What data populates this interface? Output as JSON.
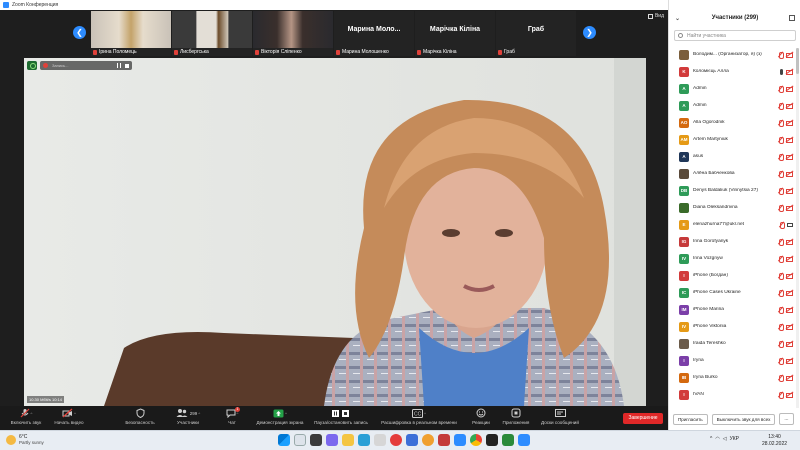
{
  "window": {
    "title": "Zoom Конференция"
  },
  "thumbnails": [
    {
      "name": "Ірина Поломець",
      "has_video": true
    },
    {
      "name": "Лисбергська",
      "has_video": true
    },
    {
      "name": "Вікторія Сліпенко",
      "has_video": true
    },
    {
      "name": "Марина Молошенко",
      "big_label": "Марина Моло...",
      "has_video": false
    },
    {
      "name": "Марічка Кіліна",
      "big_label": "Марічка Кіліна",
      "has_video": false
    },
    {
      "name": "Граб",
      "big_label": "Граб",
      "has_video": false
    }
  ],
  "view_label": "Вид",
  "video": {
    "recording_text": "Запись...",
    "net_text": "10.30 Мбit/s  10:14"
  },
  "toolbar": {
    "items": [
      {
        "icon": "mic-muted-icon",
        "label": "Включить звук"
      },
      {
        "icon": "camera-muted-icon",
        "label": "Начать видео"
      },
      {
        "icon": "shield-icon",
        "label": "Безопасность"
      },
      {
        "icon": "participants-icon",
        "label": "Участники",
        "count": "299"
      },
      {
        "icon": "chat-icon",
        "label": "Чат",
        "badge": "1"
      },
      {
        "icon": "share-screen-icon",
        "label": "Демонстрация экрана"
      },
      {
        "icon": "record-pause-icon",
        "label": "Пауза/остановить запись"
      },
      {
        "icon": "cc-icon",
        "label": "Расшифровка в реальном времени"
      },
      {
        "icon": "reactions-icon",
        "label": "Реакции"
      },
      {
        "icon": "apps-icon",
        "label": "Приложения"
      },
      {
        "icon": "whiteboard-icon",
        "label": "Доски сообщений"
      }
    ],
    "end_label": "Завершение"
  },
  "panel": {
    "title": "Участники (299)",
    "search_placeholder": "Найти участника",
    "participants": [
      {
        "initials": "",
        "name": "Володим... (Организатор, я) (з)",
        "color": "#7b5e3c",
        "photo": true,
        "mic": "muted",
        "cam": "muted"
      },
      {
        "initials": "K",
        "name": "Коломієць Алла",
        "color": "#d23b3b",
        "mic": "on",
        "cam": "muted"
      },
      {
        "initials": "A",
        "name": "Admin",
        "color": "#2e9b58",
        "mic": "muted",
        "cam": "muted"
      },
      {
        "initials": "A",
        "name": "Admin",
        "color": "#2e9b58",
        "mic": "muted",
        "cam": "muted"
      },
      {
        "initials": "AO",
        "name": "Alla Ogorodnik",
        "color": "#d4690f",
        "mic": "muted",
        "cam": "muted"
      },
      {
        "initials": "AM",
        "name": "Artem Martyniuk",
        "color": "#e59a16",
        "mic": "muted",
        "cam": "muted"
      },
      {
        "initials": "A",
        "name": "asus",
        "color": "#1f3658",
        "mic": "muted",
        "cam": "muted"
      },
      {
        "initials": "",
        "name": "Алёна Бабченкова",
        "color": "#5a4a3a",
        "photo": true,
        "mic": "muted",
        "cam": "muted"
      },
      {
        "initials": "DB",
        "name": "Denys Baldaliuk (Vinnytsia 27)",
        "color": "#2e9b58",
        "mic": "muted",
        "cam": "muted"
      },
      {
        "initials": "",
        "name": "Diana Oleksandrivna",
        "color": "#3a6b2a",
        "photo": true,
        "mic": "muted",
        "cam": "muted"
      },
      {
        "initials": "E",
        "name": "elenazhurna77@ukr.net",
        "color": "#e59a16",
        "mic": "muted",
        "cam": "on"
      },
      {
        "initials": "IG",
        "name": "Inna Gorofyanyk",
        "color": "#c63a3a",
        "mic": "muted",
        "cam": "muted"
      },
      {
        "initials": "IV",
        "name": "Inna Vozgnyw",
        "color": "#2e9b58",
        "mic": "muted",
        "cam": "muted"
      },
      {
        "initials": "I",
        "name": "iPhone (Богдан)",
        "color": "#d23b3b",
        "mic": "muted",
        "cam": "muted"
      },
      {
        "initials": "IC",
        "name": "iPhone Cases Ukraine",
        "color": "#2e9b58",
        "mic": "muted",
        "cam": "muted"
      },
      {
        "initials": "IM",
        "name": "iPhone Marina",
        "color": "#7b3fa8",
        "mic": "muted",
        "cam": "muted"
      },
      {
        "initials": "IV",
        "name": "iPhone Viktoriia",
        "color": "#e59a16",
        "mic": "muted",
        "cam": "muted"
      },
      {
        "initials": "",
        "name": "Iraida Tereshko",
        "color": "#6b5b4a",
        "photo": true,
        "mic": "muted",
        "cam": "muted"
      },
      {
        "initials": "I",
        "name": "Iryna",
        "color": "#7b3fa8",
        "mic": "muted",
        "cam": "muted"
      },
      {
        "initials": "IB",
        "name": "Iryna Burko",
        "color": "#d4690f",
        "mic": "muted",
        "cam": "muted"
      },
      {
        "initials": "I",
        "name": "IVAN",
        "color": "#d23b3b",
        "mic": "muted",
        "cam": "muted"
      }
    ],
    "invite_label": "Пригласить",
    "mute_all_label": "Выключить звук для всех",
    "more_label": "..."
  },
  "taskbar": {
    "weather_temp": "6°C",
    "weather_desc": "Partly sunny",
    "lang": "УКР",
    "time": "13:40",
    "date": "28.02.2022"
  }
}
